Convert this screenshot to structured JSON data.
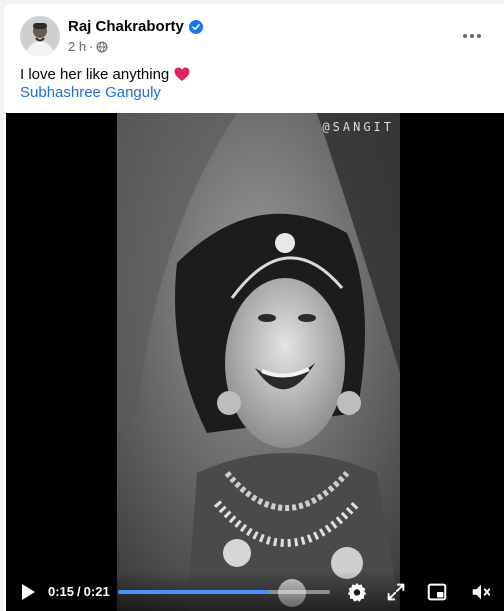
{
  "post": {
    "author": "Raj Chakraborty",
    "timestamp": "2 h",
    "separator": "·",
    "text": "I love her like anything",
    "emoji_icon": "red-heart-icon",
    "tagged_person": "Subhashree Ganguly"
  },
  "video": {
    "watermark": "@SANGIT",
    "current_time": "0:15",
    "time_separator": "/",
    "duration": "0:21",
    "progress_fraction": 0.71,
    "progress_color": "#4a90ff"
  },
  "icons": {
    "verified": "verified-badge-icon",
    "audience": "globe-icon",
    "more": "more-options-icon",
    "play": "play-icon",
    "settings": "gear-icon",
    "fullscreen": "expand-icon",
    "pip": "picture-in-picture-icon",
    "volume": "volume-muted-icon"
  },
  "colors": {
    "link": "#216fdb",
    "verified": "#1877f2",
    "meta_text": "#65676b"
  }
}
